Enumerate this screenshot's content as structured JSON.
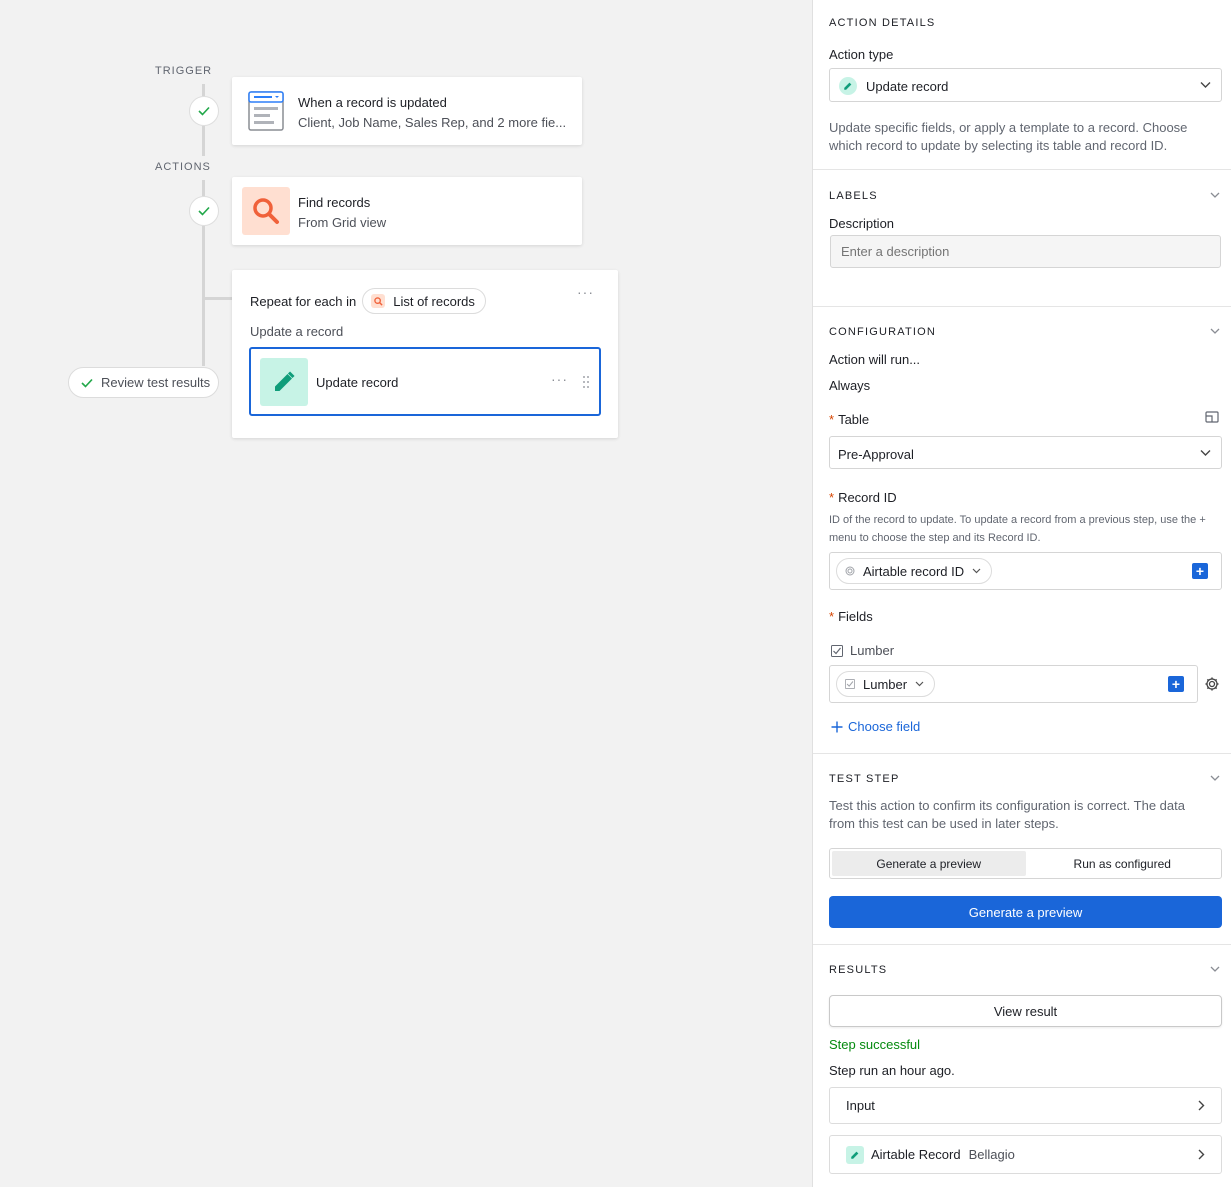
{
  "canvas": {
    "trigger_label": "TRIGGER",
    "actions_label": "ACTIONS",
    "trigger_card": {
      "title": "When a record is updated",
      "subtitle": "Client, Job Name, Sales Rep, and 2 more fie..."
    },
    "find_card": {
      "title": "Find records",
      "subtitle": "From Grid view"
    },
    "repeat_group": {
      "prefix": "Repeat for each in",
      "list_pill": "List of records",
      "subtitle": "Update a record",
      "more": "···",
      "inner_card": {
        "title": "Update record",
        "more": "···"
      }
    },
    "review_button": "Review test results"
  },
  "panel": {
    "action_details": {
      "title": "ACTION DETAILS",
      "action_type_label": "Action type",
      "action_type_value": "Update record",
      "description": "Update specific fields, or apply a template to a record. Choose which record to update by selecting its table and record ID."
    },
    "labels": {
      "title": "LABELS",
      "description_label": "Description",
      "description_placeholder": "Enter a description"
    },
    "configuration": {
      "title": "CONFIGURATION",
      "run_label": "Action will run...",
      "run_value": "Always",
      "table_label": "Table",
      "table_value": "Pre-Approval",
      "record_id_label": "Record ID",
      "record_id_help": "ID of the record to update. To update a record from a previous step, use the + menu to choose the step and its Record ID.",
      "record_id_pill": "Airtable record ID",
      "fields_label": "Fields",
      "field_name": "Lumber",
      "field_pill": "Lumber",
      "choose_field": "Choose field",
      "required_mark": "*"
    },
    "test_step": {
      "title": "TEST STEP",
      "description": "Test this action to confirm its configuration is correct. The data from this test can be used in later steps.",
      "tab_preview": "Generate a preview",
      "tab_run": "Run as configured",
      "button": "Generate a preview"
    },
    "results": {
      "title": "RESULTS",
      "view_button": "View result",
      "status": "Step successful",
      "run_time": "Step run an hour ago.",
      "input_row": "Input",
      "record_row_label": "Airtable Record",
      "record_row_value": "Bellagio"
    }
  },
  "colors": {
    "accent_blue": "#1a66d9",
    "success_green": "#048a0e",
    "teal_icon_bg": "#c7f3e6",
    "teal_icon": "#0f9d7a",
    "orange_icon_bg": "#ffdfd1",
    "orange_icon": "#f0613a"
  }
}
